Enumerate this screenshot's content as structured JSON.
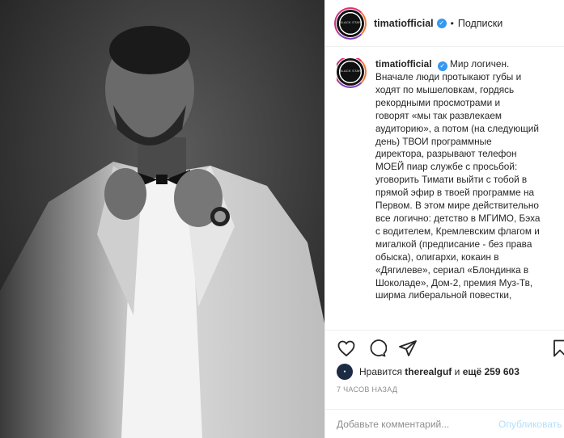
{
  "post": {
    "username": "timatiofficial",
    "follow_label": "Подписки",
    "avatar_logo_text": "BLACK STAR",
    "caption_lines": [
      "Мир логичен.",
      "Вначале люди протыкают губы и",
      "ходят по мышеловкам, гордясь",
      "рекордными просмотрами и",
      "говорят «мы так развлекаем",
      "аудиторию», а потом (на следующий",
      "день) ТВОИ программные",
      "директора, разрывают телефон",
      "МОЕЙ пиар службе с просьбой:",
      "уговорить Тимати выйти с тобой в",
      "прямой эфир в твоей программе на",
      "Первом. В этом мире действительно",
      "все логично: детство в МГИМО, Бэха",
      "с водителем, Кремлевским флагом и",
      "мигалкой (предписание - без права",
      "обыска), олигархи, кокаин в",
      "«Дягилеве», сериал «Блондинка в",
      "Шоколаде», Дом-2, премия Муз-Тв,",
      "ширма либеральной повестки,"
    ],
    "likes": {
      "prefix": "Нравится",
      "user": "therealguf",
      "suffix_word": "и",
      "others": "ещё 259 603"
    },
    "timestamp": "7 ЧАСОВ НАЗАД",
    "comment": {
      "placeholder": "Добавьте комментарий...",
      "publish_label": "Опубликовать"
    }
  },
  "colors": {
    "verified": "#3897f0",
    "publish_disabled": "#b2dffc",
    "muted_text": "#8e8e8e"
  },
  "icons": [
    "heart-icon",
    "comment-icon",
    "share-icon",
    "bookmark-icon",
    "verified-badge-icon"
  ]
}
